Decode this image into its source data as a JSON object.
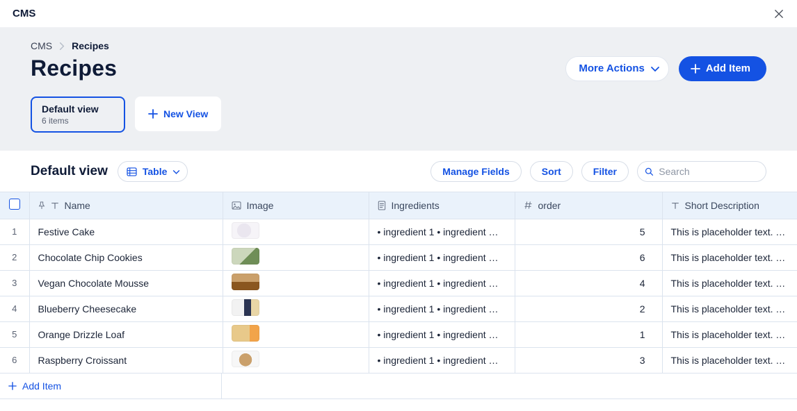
{
  "appbar": {
    "title": "CMS"
  },
  "breadcrumb": {
    "root": "CMS",
    "current": "Recipes"
  },
  "page": {
    "title": "Recipes"
  },
  "actions": {
    "more": "More Actions",
    "add_item": "Add Item"
  },
  "views": {
    "default_name": "Default view",
    "default_items": "6 items",
    "new_view": "New View"
  },
  "toolbar": {
    "view_title": "Default view",
    "mode_label": "Table",
    "manage_fields": "Manage Fields",
    "sort": "Sort",
    "filter": "Filter",
    "search_placeholder": "Search"
  },
  "columns": {
    "name": "Name",
    "image": "Image",
    "ingredients": "Ingredients",
    "order": "order",
    "short_desc": "Short Description"
  },
  "ingredients_text": "• ingredient 1 • ingredient …",
  "desc_text": "This is placeholder text. T…",
  "rows": [
    {
      "idx": "1",
      "name": "Festive Cake",
      "thumb": "festive",
      "order": "5"
    },
    {
      "idx": "2",
      "name": "Chocolate Chip Cookies",
      "thumb": "cookie",
      "order": "6"
    },
    {
      "idx": "3",
      "name": "Vegan Chocolate Mousse",
      "thumb": "mousse",
      "order": "4"
    },
    {
      "idx": "4",
      "name": "Blueberry Cheesecake",
      "thumb": "blueberry",
      "order": "2"
    },
    {
      "idx": "5",
      "name": "Orange Drizzle Loaf",
      "thumb": "orange",
      "order": "1"
    },
    {
      "idx": "6",
      "name": "Raspberry Croissant",
      "thumb": "croissant",
      "order": "3"
    }
  ],
  "footer": {
    "add_item": "Add Item"
  }
}
